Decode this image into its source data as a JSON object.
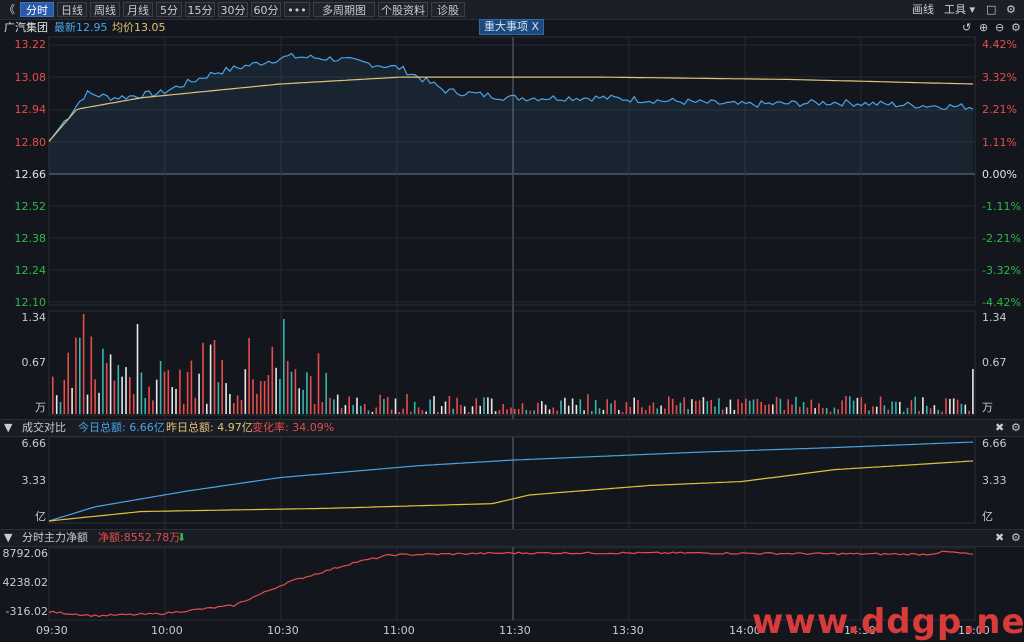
{
  "toolbar": {
    "collapse": "《",
    "tabs": [
      "分时",
      "日线",
      "周线",
      "月线",
      "5分",
      "15分",
      "30分",
      "60分",
      "•••",
      "多周期图",
      "个股资料",
      "诊股"
    ],
    "right": [
      "画线",
      "工具"
    ]
  },
  "info": {
    "name": "广汽集团",
    "latest": "最新12.95",
    "avg": "均价13.05",
    "event_tag": "重大事项 X"
  },
  "colors": {
    "up": "#e74c4c",
    "down": "#2fb84a",
    "price": "#4aa3e8",
    "avg": "#e2c27a",
    "bg": "#13161c"
  },
  "price_axis": {
    "left": [
      "13.22",
      "13.08",
      "12.94",
      "12.80",
      "12.66",
      "12.52",
      "12.38",
      "12.24",
      "12.10"
    ],
    "right": [
      "4.42%",
      "3.32%",
      "2.21%",
      "1.11%",
      "0.00%",
      "-1.11%",
      "-2.21%",
      "-3.32%",
      "-4.42%"
    ]
  },
  "vol_axis": {
    "left": [
      "1.34",
      "0.67",
      "万"
    ],
    "right": [
      "1.34",
      "0.67",
      "万"
    ]
  },
  "amount_panel": {
    "title": "成交对比",
    "today": "今日总额: 6.66亿",
    "yesterday": "昨日总额: 4.97亿",
    "change": "变化率: 34.09%",
    "axis_left": [
      "6.66",
      "3.33",
      "亿"
    ],
    "axis_right": [
      "6.66",
      "3.33",
      "亿"
    ]
  },
  "flow_panel": {
    "title": "分时主力净额",
    "net": "净额:8552.78万",
    "arrow": "⬇",
    "axis_left": [
      "8792.06",
      "4238.02",
      "-316.02"
    ]
  },
  "times": [
    "09:30",
    "10:00",
    "10:30",
    "11:00",
    "11:30",
    "13:30",
    "14:00",
    "14:30",
    "15:00"
  ],
  "watermark": "www.ddgp.net",
  "chart_data": {
    "type": "line",
    "x": [
      "09:30",
      "10:00",
      "10:30",
      "11:00",
      "11:30",
      "13:30",
      "14:00",
      "14:30",
      "15:00"
    ],
    "series": [
      {
        "name": "最新",
        "values": [
          12.8,
          13.01,
          13.17,
          13.08,
          12.99,
          12.99,
          12.96,
          12.97,
          12.95
        ]
      },
      {
        "name": "均价",
        "values": [
          12.8,
          12.99,
          13.06,
          13.08,
          13.08,
          13.08,
          13.07,
          13.06,
          13.05
        ]
      }
    ],
    "ylim": [
      12.1,
      13.22
    ]
  }
}
